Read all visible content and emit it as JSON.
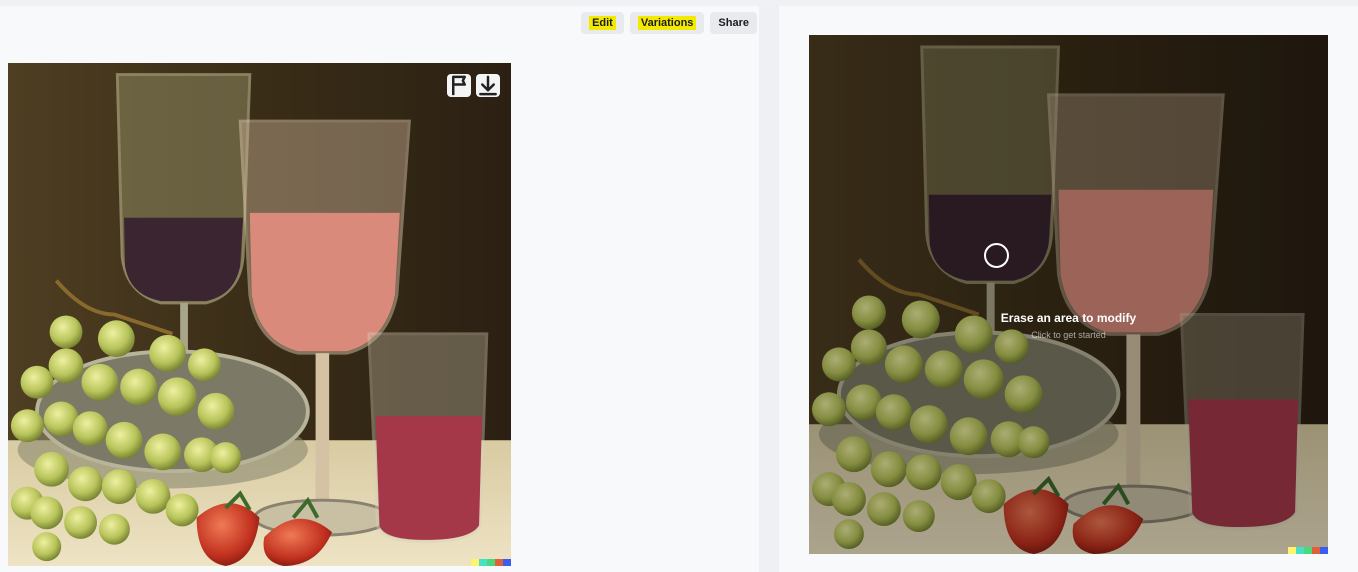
{
  "toolbar": {
    "edit_label": "Edit",
    "variations_label": "Variations",
    "share_label": "Share",
    "highlight_color": "#f2ea00"
  },
  "generated_image": {
    "subject": "still life painting: wine glasses, rosé wine, grapes, strawberries",
    "actions": [
      {
        "icon": "flag-icon"
      },
      {
        "icon": "download-icon"
      }
    ],
    "signature_colors": [
      "#fff46a",
      "#46e0c4",
      "#4ad87a",
      "#e0603a",
      "#3c5cf0"
    ]
  },
  "editor": {
    "prompt_title": "Erase an area to modify",
    "prompt_hint": "Click to get started"
  }
}
